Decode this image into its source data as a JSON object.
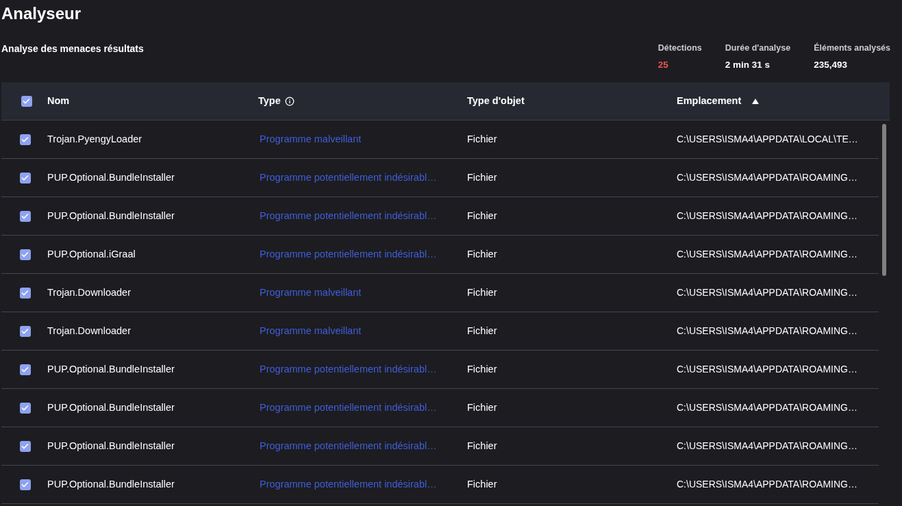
{
  "title": "Analyseur",
  "subtitle": "Analyse des menaces résultats",
  "stats": [
    {
      "label": "Détections",
      "value": "25",
      "kind": "alert"
    },
    {
      "label": "Durée d'analyse",
      "value": "2 min 31 s",
      "kind": "plain"
    },
    {
      "label": "Éléments analysés",
      "value": "235,493",
      "kind": "plain"
    }
  ],
  "table": {
    "all_checked": true,
    "columns": [
      {
        "label": "Nom",
        "info": false,
        "sorted": false
      },
      {
        "label": "Type",
        "info": true,
        "sorted": false
      },
      {
        "label": "Type d'objet",
        "info": false,
        "sorted": false
      },
      {
        "label": "Emplacement",
        "info": false,
        "sorted": true
      }
    ],
    "rows": [
      {
        "checked": true,
        "name": "Trojan.PyengyLoader",
        "type": "Programme malveillant",
        "object_type": "Fichier",
        "location": "C:\\USERS\\ISMA4\\APPDATA\\LOCAL\\TE…"
      },
      {
        "checked": true,
        "name": "PUP.Optional.BundleInstaller",
        "type": "Programme potentiellement indésirabl…",
        "object_type": "Fichier",
        "location": "C:\\USERS\\ISMA4\\APPDATA\\ROAMING…"
      },
      {
        "checked": true,
        "name": "PUP.Optional.BundleInstaller",
        "type": "Programme potentiellement indésirabl…",
        "object_type": "Fichier",
        "location": "C:\\USERS\\ISMA4\\APPDATA\\ROAMING…"
      },
      {
        "checked": true,
        "name": "PUP.Optional.iGraal",
        "type": "Programme potentiellement indésirabl…",
        "object_type": "Fichier",
        "location": "C:\\USERS\\ISMA4\\APPDATA\\ROAMING…"
      },
      {
        "checked": true,
        "name": "Trojan.Downloader",
        "type": "Programme malveillant",
        "object_type": "Fichier",
        "location": "C:\\USERS\\ISMA4\\APPDATA\\ROAMING…"
      },
      {
        "checked": true,
        "name": "Trojan.Downloader",
        "type": "Programme malveillant",
        "object_type": "Fichier",
        "location": "C:\\USERS\\ISMA4\\APPDATA\\ROAMING…"
      },
      {
        "checked": true,
        "name": "PUP.Optional.BundleInstaller",
        "type": "Programme potentiellement indésirabl…",
        "object_type": "Fichier",
        "location": "C:\\USERS\\ISMA4\\APPDATA\\ROAMING…"
      },
      {
        "checked": true,
        "name": "PUP.Optional.BundleInstaller",
        "type": "Programme potentiellement indésirabl…",
        "object_type": "Fichier",
        "location": "C:\\USERS\\ISMA4\\APPDATA\\ROAMING…"
      },
      {
        "checked": true,
        "name": "PUP.Optional.BundleInstaller",
        "type": "Programme potentiellement indésirabl…",
        "object_type": "Fichier",
        "location": "C:\\USERS\\ISMA4\\APPDATA\\ROAMING…"
      },
      {
        "checked": true,
        "name": "PUP.Optional.BundleInstaller",
        "type": "Programme potentiellement indésirabl…",
        "object_type": "Fichier",
        "location": "C:\\USERS\\ISMA4\\APPDATA\\ROAMING…"
      }
    ]
  }
}
